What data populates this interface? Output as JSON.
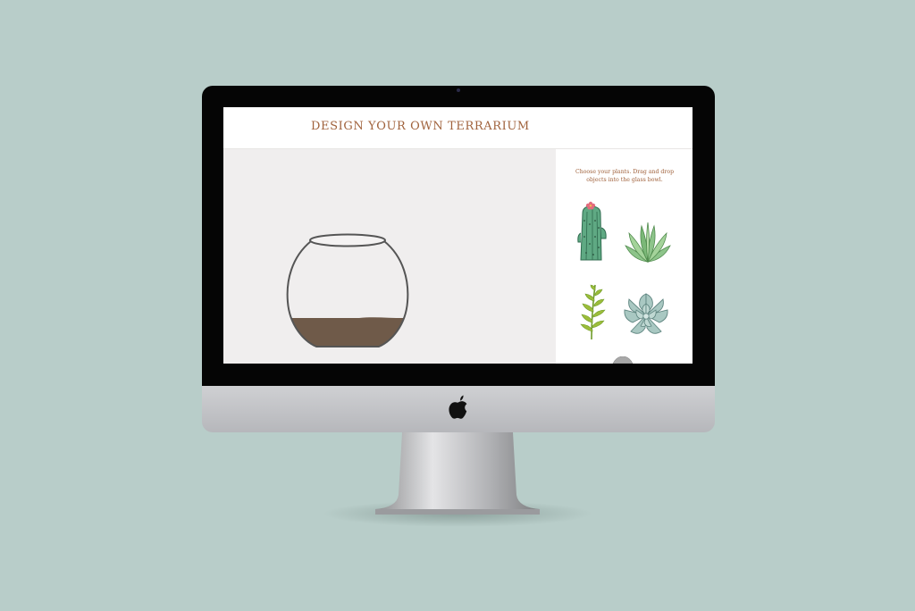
{
  "page": {
    "title": "DESIGN YOUR OWN TERRARIUM"
  },
  "sidebar": {
    "instructions": "Choose your plants. Drag and drop objects into the glass bowl.",
    "plants": [
      {
        "name": "cactus",
        "icon": "cactus-icon"
      },
      {
        "name": "aloe",
        "icon": "aloe-icon"
      },
      {
        "name": "fern",
        "icon": "fern-icon"
      },
      {
        "name": "echeveria",
        "icon": "echeveria-icon"
      }
    ]
  },
  "colors": {
    "background": "#b8cdc9",
    "title": "#a0623c",
    "canvas": "#f0eeee",
    "soil": "#6f5a49",
    "cactus": "#5fa983",
    "aloe": "#8dc48a",
    "fern": "#9cbd3a",
    "echeveria": "#a9c8c2"
  }
}
